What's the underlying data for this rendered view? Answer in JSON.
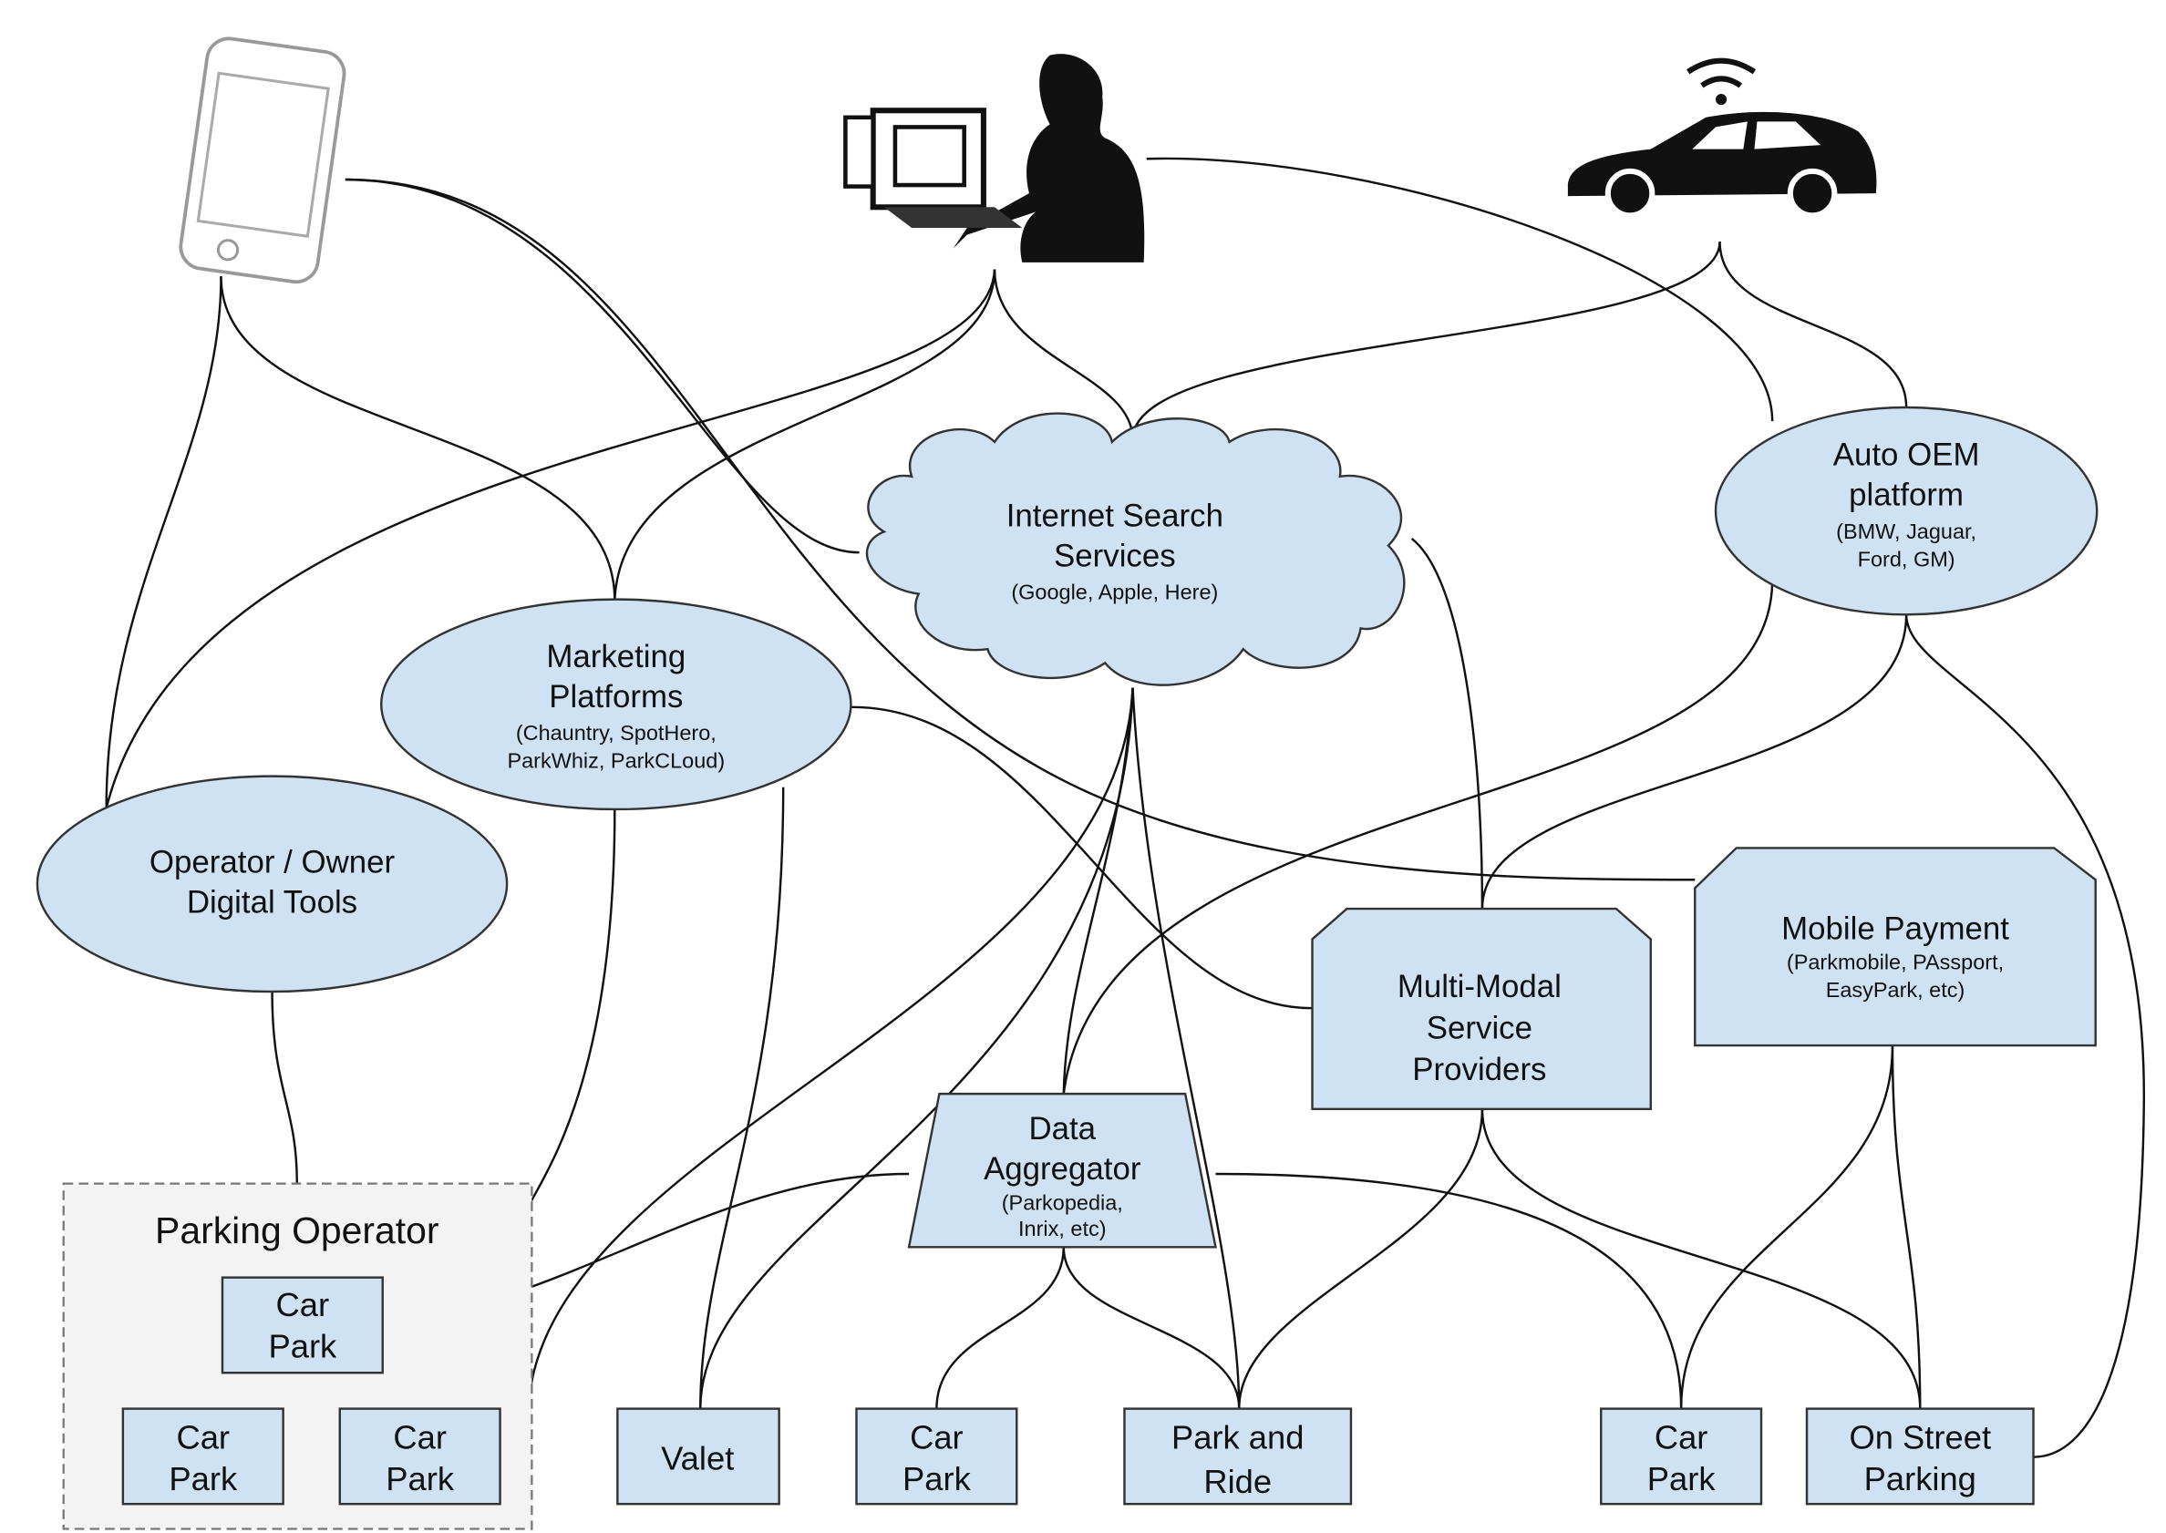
{
  "colors": {
    "node_fill": "#cfe2f3",
    "group_fill": "#f3f3f3",
    "line": "#111111"
  },
  "icons": [
    "smartphone-icon",
    "person-at-computer-icon",
    "connected-car-icon"
  ],
  "nodes": {
    "internet": {
      "line1": "Internet Search",
      "line2": "Services",
      "sub": "(Google, Apple, Here)"
    },
    "auto_oem": {
      "line1": "Auto OEM",
      "line2": "platform",
      "sub1": "(BMW, Jaguar,",
      "sub2": "Ford, GM)"
    },
    "marketing": {
      "line1": "Marketing",
      "line2": "Platforms",
      "sub1": "(Chauntry, SpotHero,",
      "sub2": "ParkWhiz, ParkCLoud)"
    },
    "operator_tools": {
      "line1": "Operator / Owner",
      "line2": "Digital Tools"
    },
    "multimodal": {
      "line1": "Multi-Modal",
      "line2": "Service",
      "line3": "Providers"
    },
    "mobile_payment": {
      "line1": "Mobile Payment",
      "sub1": "(Parkmobile, PAssport,",
      "sub2": "EasyPark, etc)"
    },
    "aggregator": {
      "line1": "Data",
      "line2": "Aggregator",
      "sub1": "(Parkopedia,",
      "sub2": "Inrix, etc)"
    },
    "parking_operator": {
      "title": "Parking Operator"
    },
    "car_park": {
      "line1": "Car",
      "line2": "Park"
    },
    "valet": {
      "label": "Valet"
    },
    "park_ride": {
      "line1": "Park and",
      "line2": "Ride"
    },
    "on_street": {
      "line1": "On Street",
      "line2": "Parking"
    }
  }
}
